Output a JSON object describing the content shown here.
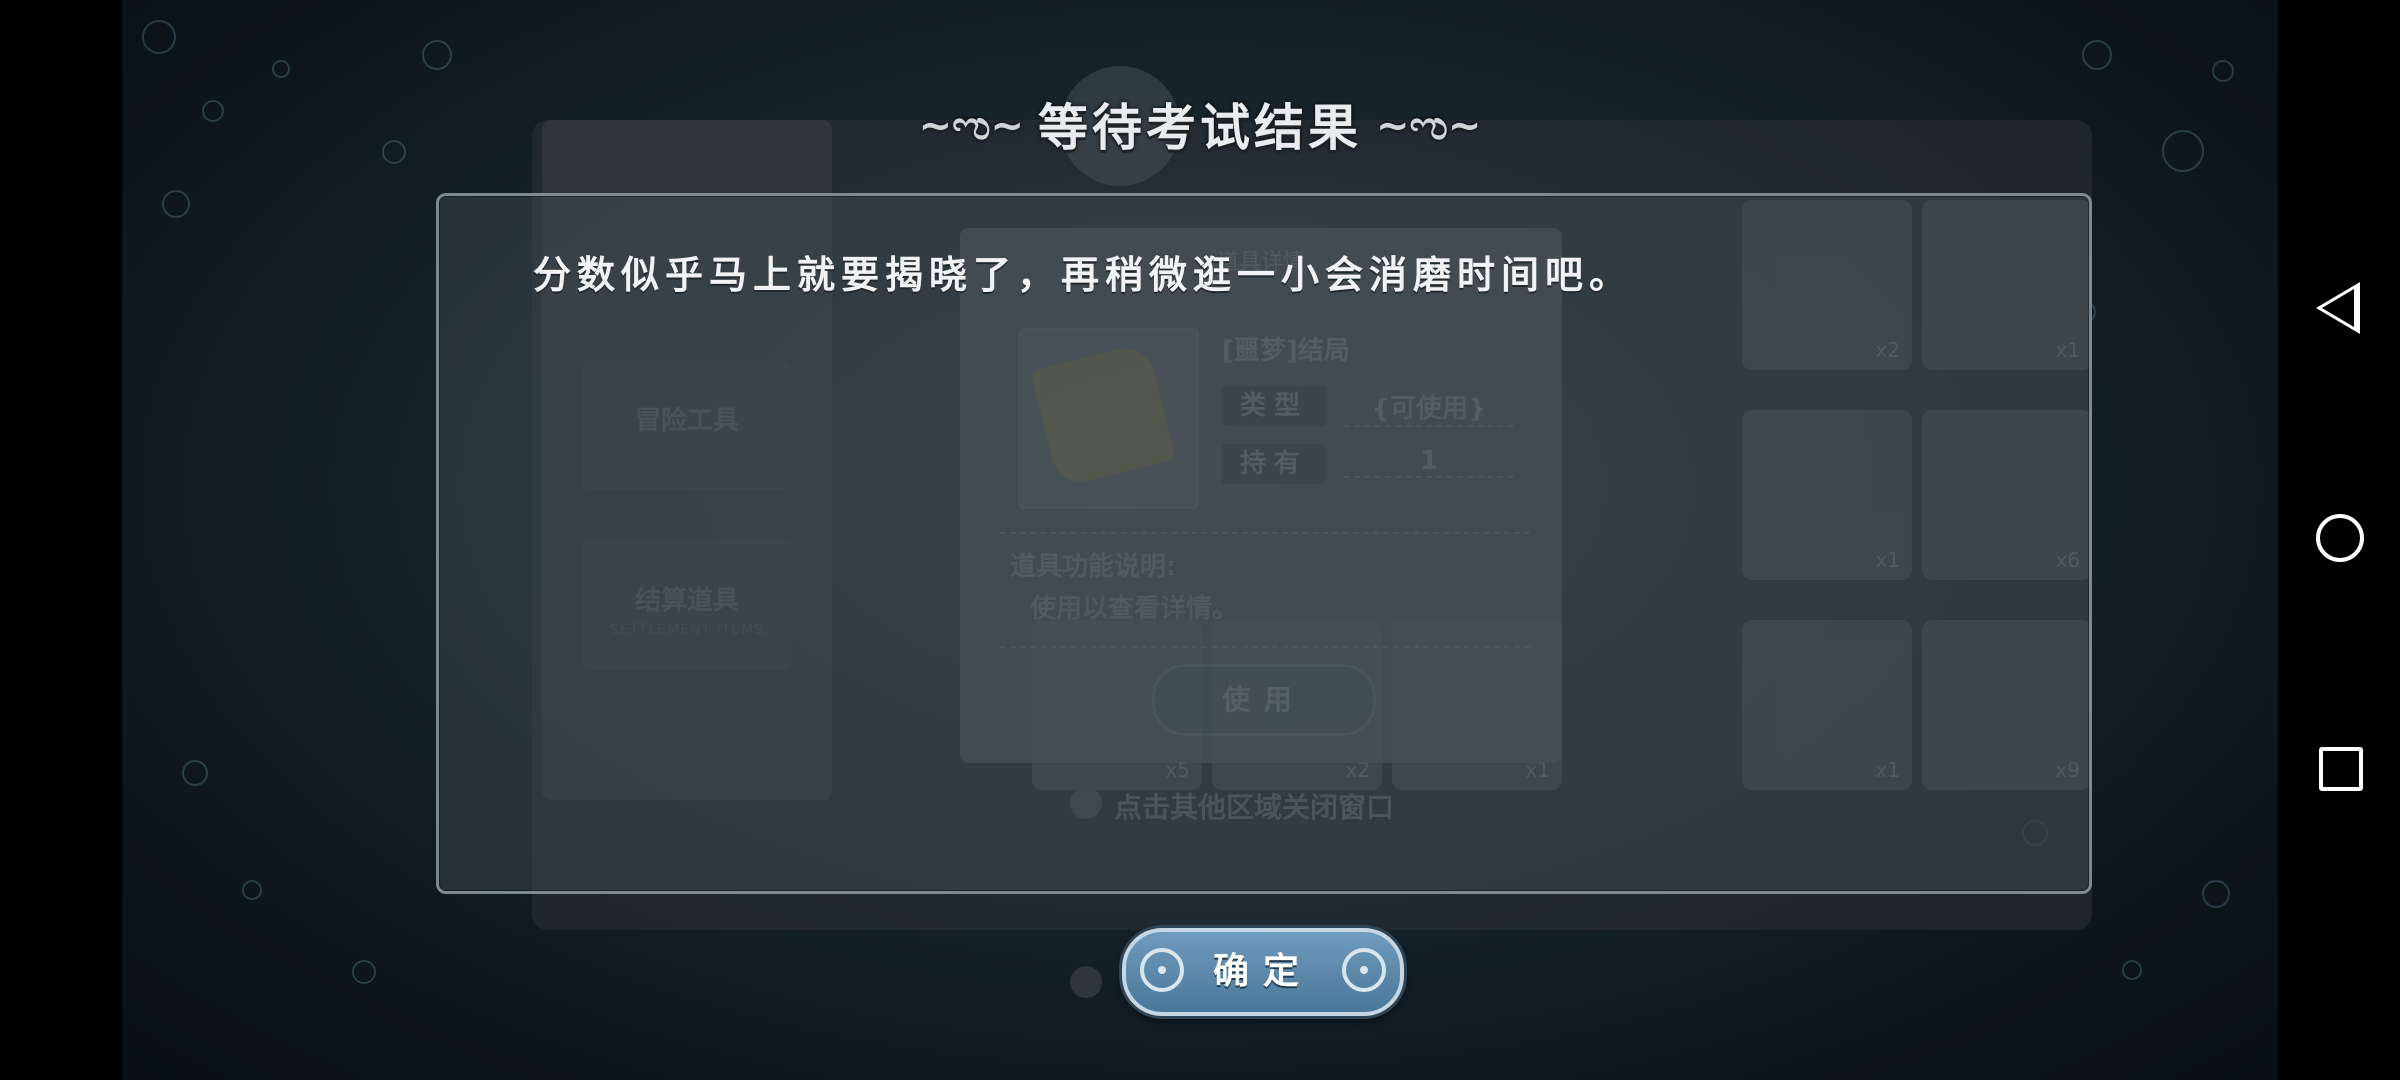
{
  "overlay": {
    "title": "等待考试结果",
    "title_deco_left": "~ಌ~",
    "title_deco_right": "~ಌ~",
    "message": "分数似乎马上就要揭晓了，再稍微逛一小会消磨时间吧。",
    "confirm_label": "确定"
  },
  "background": {
    "sidebar": [
      {
        "label": "冒险工具",
        "sub": ""
      },
      {
        "label": "结算道具",
        "sub": "SETTLEMENT ITEMS"
      }
    ],
    "detail": {
      "header": "道具详情",
      "item_name": "[噩梦]结局",
      "type_label": "类型",
      "type_value": "{可使用}",
      "hold_label": "持有",
      "hold_value": "1",
      "desc_title": "道具功能说明:",
      "desc_body": "使用以查看详情。",
      "use_label": "使用"
    },
    "hint": "点击其他区域关闭窗口",
    "slot_counts": [
      "x2",
      "x1",
      "x1",
      "x6",
      "x5",
      "x2",
      "x1",
      "x1",
      "x9"
    ]
  },
  "nav": {
    "back": "back-icon",
    "home": "home-icon",
    "recent": "recent-apps-icon"
  }
}
